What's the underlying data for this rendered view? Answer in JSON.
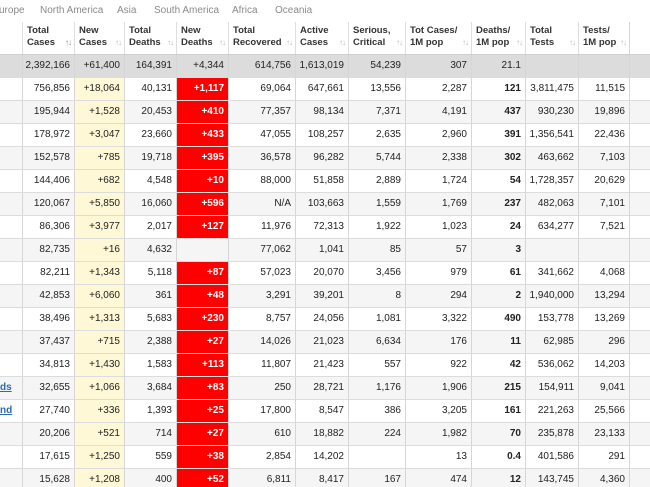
{
  "tabs": [
    "urope",
    "North America",
    "Asia",
    "South America",
    "Africa",
    "Oceania"
  ],
  "columns": [
    {
      "key": "total_cases",
      "label": "Total Cases",
      "sort": "active"
    },
    {
      "key": "new_cases",
      "label": "New Cases"
    },
    {
      "key": "total_deaths",
      "label": "Total Deaths"
    },
    {
      "key": "new_deaths",
      "label": "New Deaths"
    },
    {
      "key": "total_recovered",
      "label": "Total Recovered"
    },
    {
      "key": "active_cases",
      "label": "Active Cases"
    },
    {
      "key": "serious_critical",
      "label": "Serious, Critical"
    },
    {
      "key": "tot_cases_1m",
      "label": "Tot Cases/ 1M pop"
    },
    {
      "key": "deaths_1m",
      "label": "Deaths/ 1M pop"
    },
    {
      "key": "total_tests",
      "label": "Total Tests"
    },
    {
      "key": "tests_1m",
      "label": "Tests/ 1M pop"
    }
  ],
  "sort_icon": "sort-arrows-icon",
  "colors": {
    "new_cases_bg": "#fff8d6",
    "new_deaths_bg": "#ff0000",
    "total_row_bg": "#dcdcdc",
    "link": "#2a6ab3"
  },
  "total_row": [
    "2,392,166",
    "+61,400",
    "164,391",
    "+4,344",
    "614,756",
    "1,613,019",
    "54,239",
    "307",
    "21.1",
    "",
    ""
  ],
  "rows": [
    {
      "country": "",
      "values": [
        "756,856",
        "+18,064",
        "40,131",
        "+1,117",
        "69,064",
        "647,661",
        "13,556",
        "2,287",
        "121",
        "3,811,475",
        "11,515"
      ]
    },
    {
      "country": "",
      "values": [
        "195,944",
        "+1,528",
        "20,453",
        "+410",
        "77,357",
        "98,134",
        "7,371",
        "4,191",
        "437",
        "930,230",
        "19,896"
      ]
    },
    {
      "country": "",
      "values": [
        "178,972",
        "+3,047",
        "23,660",
        "+433",
        "47,055",
        "108,257",
        "2,635",
        "2,960",
        "391",
        "1,356,541",
        "22,436"
      ]
    },
    {
      "country": "",
      "values": [
        "152,578",
        "+785",
        "19,718",
        "+395",
        "36,578",
        "96,282",
        "5,744",
        "2,338",
        "302",
        "463,662",
        "7,103"
      ]
    },
    {
      "country": "",
      "values": [
        "144,406",
        "+682",
        "4,548",
        "+10",
        "88,000",
        "51,858",
        "2,889",
        "1,724",
        "54",
        "1,728,357",
        "20,629"
      ]
    },
    {
      "country": "",
      "values": [
        "120,067",
        "+5,850",
        "16,060",
        "+596",
        "N/A",
        "103,663",
        "1,559",
        "1,769",
        "237",
        "482,063",
        "7,101"
      ]
    },
    {
      "country": "",
      "values": [
        "86,306",
        "+3,977",
        "2,017",
        "+127",
        "11,976",
        "72,313",
        "1,922",
        "1,023",
        "24",
        "634,277",
        "7,521"
      ]
    },
    {
      "country": "",
      "values": [
        "82,735",
        "+16",
        "4,632",
        "",
        "77,062",
        "1,041",
        "85",
        "57",
        "3",
        "",
        ""
      ]
    },
    {
      "country": "",
      "values": [
        "82,211",
        "+1,343",
        "5,118",
        "+87",
        "57,023",
        "20,070",
        "3,456",
        "979",
        "61",
        "341,662",
        "4,068"
      ]
    },
    {
      "country": "",
      "values": [
        "42,853",
        "+6,060",
        "361",
        "+48",
        "3,291",
        "39,201",
        "8",
        "294",
        "2",
        "1,940,000",
        "13,294"
      ]
    },
    {
      "country": "",
      "values": [
        "38,496",
        "+1,313",
        "5,683",
        "+230",
        "8,757",
        "24,056",
        "1,081",
        "3,322",
        "490",
        "153,778",
        "13,269"
      ]
    },
    {
      "country": "",
      "values": [
        "37,437",
        "+715",
        "2,388",
        "+27",
        "14,026",
        "21,023",
        "6,634",
        "176",
        "11",
        "62,985",
        "296"
      ]
    },
    {
      "country": "",
      "values": [
        "34,813",
        "+1,430",
        "1,583",
        "+113",
        "11,807",
        "21,423",
        "557",
        "922",
        "42",
        "536,062",
        "14,203"
      ]
    },
    {
      "country": "ds",
      "values": [
        "32,655",
        "+1,066",
        "3,684",
        "+83",
        "250",
        "28,721",
        "1,176",
        "1,906",
        "215",
        "154,911",
        "9,041"
      ]
    },
    {
      "country": "nd",
      "values": [
        "27,740",
        "+336",
        "1,393",
        "+25",
        "17,800",
        "8,547",
        "386",
        "3,205",
        "161",
        "221,263",
        "25,566"
      ]
    },
    {
      "country": "",
      "values": [
        "20,206",
        "+521",
        "714",
        "+27",
        "610",
        "18,882",
        "224",
        "1,982",
        "70",
        "235,878",
        "23,133"
      ]
    },
    {
      "country": "",
      "values": [
        "17,615",
        "+1,250",
        "559",
        "+38",
        "2,854",
        "14,202",
        "",
        "13",
        "0.4",
        "401,586",
        "291"
      ]
    },
    {
      "country": "",
      "values": [
        "15,628",
        "+1,208",
        "400",
        "+52",
        "6,811",
        "8,417",
        "167",
        "474",
        "12",
        "143,745",
        "4,360"
      ]
    }
  ]
}
